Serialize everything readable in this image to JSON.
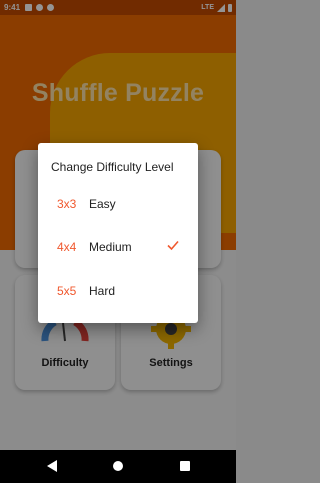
{
  "status_bar": {
    "time": "9:41",
    "network": "LTE"
  },
  "app": {
    "title": "Shuffle Puzzle"
  },
  "cards": {
    "difficulty_label": "Difficulty",
    "settings_label": "Settings"
  },
  "dialog": {
    "title": "Change Difficulty Level",
    "options": [
      {
        "size": "3x3",
        "label": "Easy",
        "selected": false
      },
      {
        "size": "4x4",
        "label": "Medium",
        "selected": true
      },
      {
        "size": "5x5",
        "label": "Hard",
        "selected": false
      }
    ]
  },
  "colors": {
    "accent": "#f0582e",
    "header": "#f06a00",
    "header_blob": "#f5a400"
  },
  "icons": [
    "back-icon",
    "home-icon",
    "recents-icon",
    "check-icon",
    "gauge-icon",
    "gear-icon"
  ]
}
